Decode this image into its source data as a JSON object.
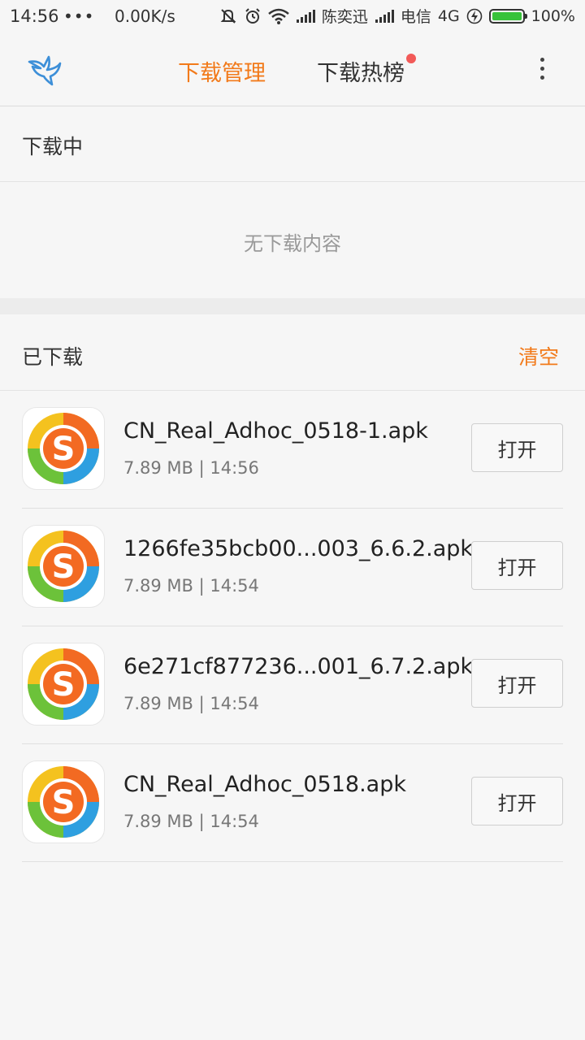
{
  "status_bar": {
    "time": "14:56",
    "dots": "•••",
    "speed": "0.00K/s",
    "carrier1": "陈奕迅",
    "carrier2": "电信",
    "network": "4G",
    "battery": "100%",
    "battery_color": "#37c23a"
  },
  "nav": {
    "tab_download_manage": "下载管理",
    "tab_hot_list": "下载热榜",
    "accent_color": "#f27a1a",
    "badge_color": "#f25a58"
  },
  "downloading": {
    "title": "下载中",
    "empty_text": "无下载内容"
  },
  "downloaded": {
    "title": "已下载",
    "clear_label": "清空",
    "items": [
      {
        "name": "CN_Real_Adhoc_0518-1.apk",
        "meta": "7.89 MB | 14:56",
        "action": "打开"
      },
      {
        "name": "1266fe35bcb00...003_6.6.2.apk",
        "meta": "7.89 MB | 14:54",
        "action": "打开"
      },
      {
        "name": "6e271cf877236...001_6.7.2.apk",
        "meta": "7.89 MB | 14:54",
        "action": "打开"
      },
      {
        "name": "CN_Real_Adhoc_0518.apk",
        "meta": "7.89 MB | 14:54",
        "action": "打开"
      }
    ]
  }
}
